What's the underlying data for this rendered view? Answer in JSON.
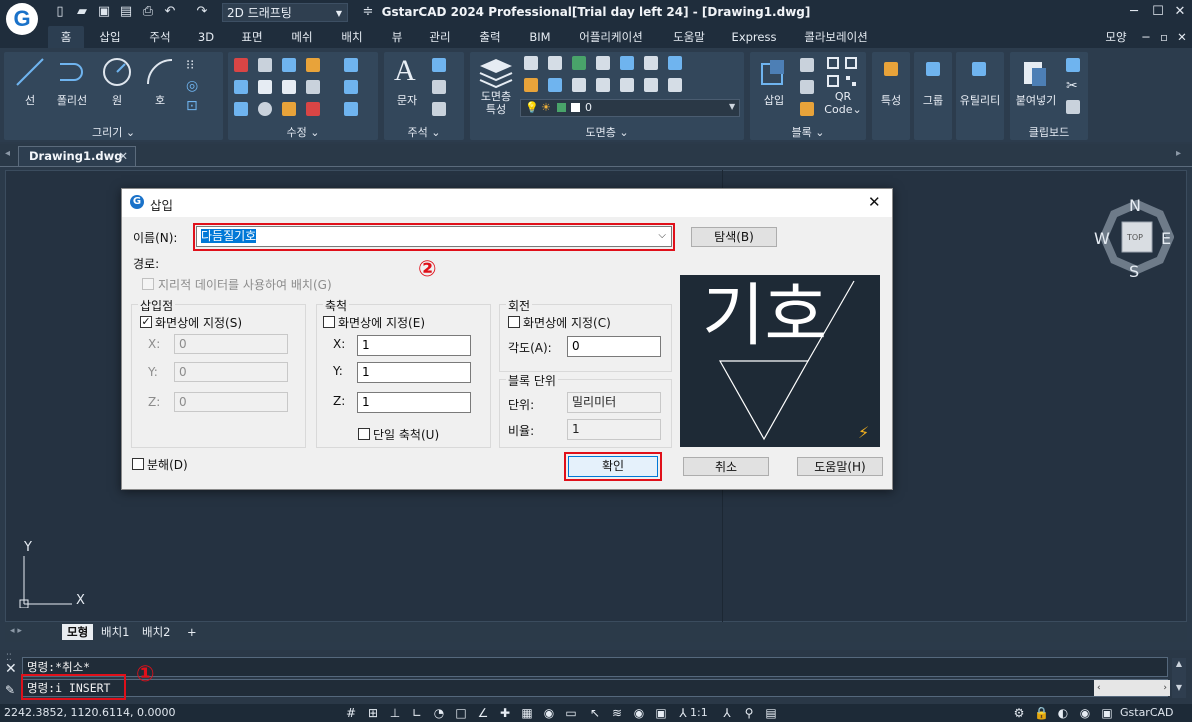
{
  "window": {
    "title": "GstarCAD 2024 Professional[Trial day left 24] - [Drawing1.dwg]",
    "workspace": "2D 드래프팅",
    "logo": "G",
    "controls": [
      "─",
      "☐",
      "✕"
    ],
    "doc_controls": [
      "모양",
      "─",
      "▫",
      "✕"
    ]
  },
  "menu_tabs": [
    "홈",
    "삽입",
    "주석",
    "3D",
    "표면",
    "메쉬",
    "배치",
    "뷰",
    "관리",
    "출력",
    "BIM",
    "어플리케이션",
    "도움말",
    "Express",
    "콜라보레이션"
  ],
  "ribbon": {
    "draw": {
      "label": "그리기",
      "items": [
        "선",
        "폴리선",
        "원",
        "호"
      ]
    },
    "modify": {
      "label": "수정"
    },
    "annotation": {
      "label": "주석",
      "items": [
        "문자"
      ]
    },
    "layers": {
      "label": "도면층",
      "items": [
        "도면층",
        "특성"
      ],
      "current_layer": "0"
    },
    "block": {
      "label": "블록",
      "items": [
        "삽입",
        "QR",
        "Code"
      ]
    },
    "properties": {
      "items": [
        "특성",
        "그룹",
        "유틸리티"
      ]
    },
    "clipboard": {
      "label": "클립보드",
      "items": [
        "붙여넣기"
      ]
    }
  },
  "doc_tab": {
    "name": "Drawing1.dwg",
    "close": "✕"
  },
  "viewcube": {
    "n": "N",
    "s": "S",
    "e": "E",
    "w": "W",
    "top": "TOP"
  },
  "ucs": {
    "x": "X",
    "y": "Y"
  },
  "layout_tabs": [
    "모형",
    "배치1",
    "배치2",
    "+"
  ],
  "command": {
    "history": "명령:*취소*",
    "input": "명령:i INSERT",
    "marker_1": "①"
  },
  "status": {
    "coords": "2242.3852, 1120.6114, 0.0000",
    "scale": "1:1",
    "app": "GstarCAD"
  },
  "dialog": {
    "title": "삽입",
    "name_label": "이름(N):",
    "name_value": "다듬질기호",
    "browse_button": "탐색(B)",
    "marker_2": "②",
    "path_label": "경로:",
    "geo_checkbox": "지리적 데이터를 사용하여 배치(G)",
    "insertion": {
      "title": "삽입점",
      "specify": "화면상에 지정(S)",
      "x_label": "X:",
      "x_value": "0",
      "y_label": "Y:",
      "y_value": "0",
      "z_label": "Z:",
      "z_value": "0"
    },
    "scale": {
      "title": "축척",
      "specify": "화면상에 지정(E)",
      "x_label": "X:",
      "x_value": "1",
      "y_label": "Y:",
      "y_value": "1",
      "z_label": "Z:",
      "z_value": "1",
      "uniform": "단일 축척(U)"
    },
    "rotation": {
      "title": "회전",
      "specify": "화면상에 지정(C)",
      "angle_label": "각도(A):",
      "angle_value": "0"
    },
    "block_unit": {
      "title": "블록 단위",
      "unit_label": "단위:",
      "unit_value": "밀리미터",
      "factor_label": "비율:",
      "factor_value": "1"
    },
    "preview_text": "기호",
    "explode": "분해(D)",
    "ok_button": "확인",
    "cancel_button": "취소",
    "help_button": "도움말(H)"
  }
}
